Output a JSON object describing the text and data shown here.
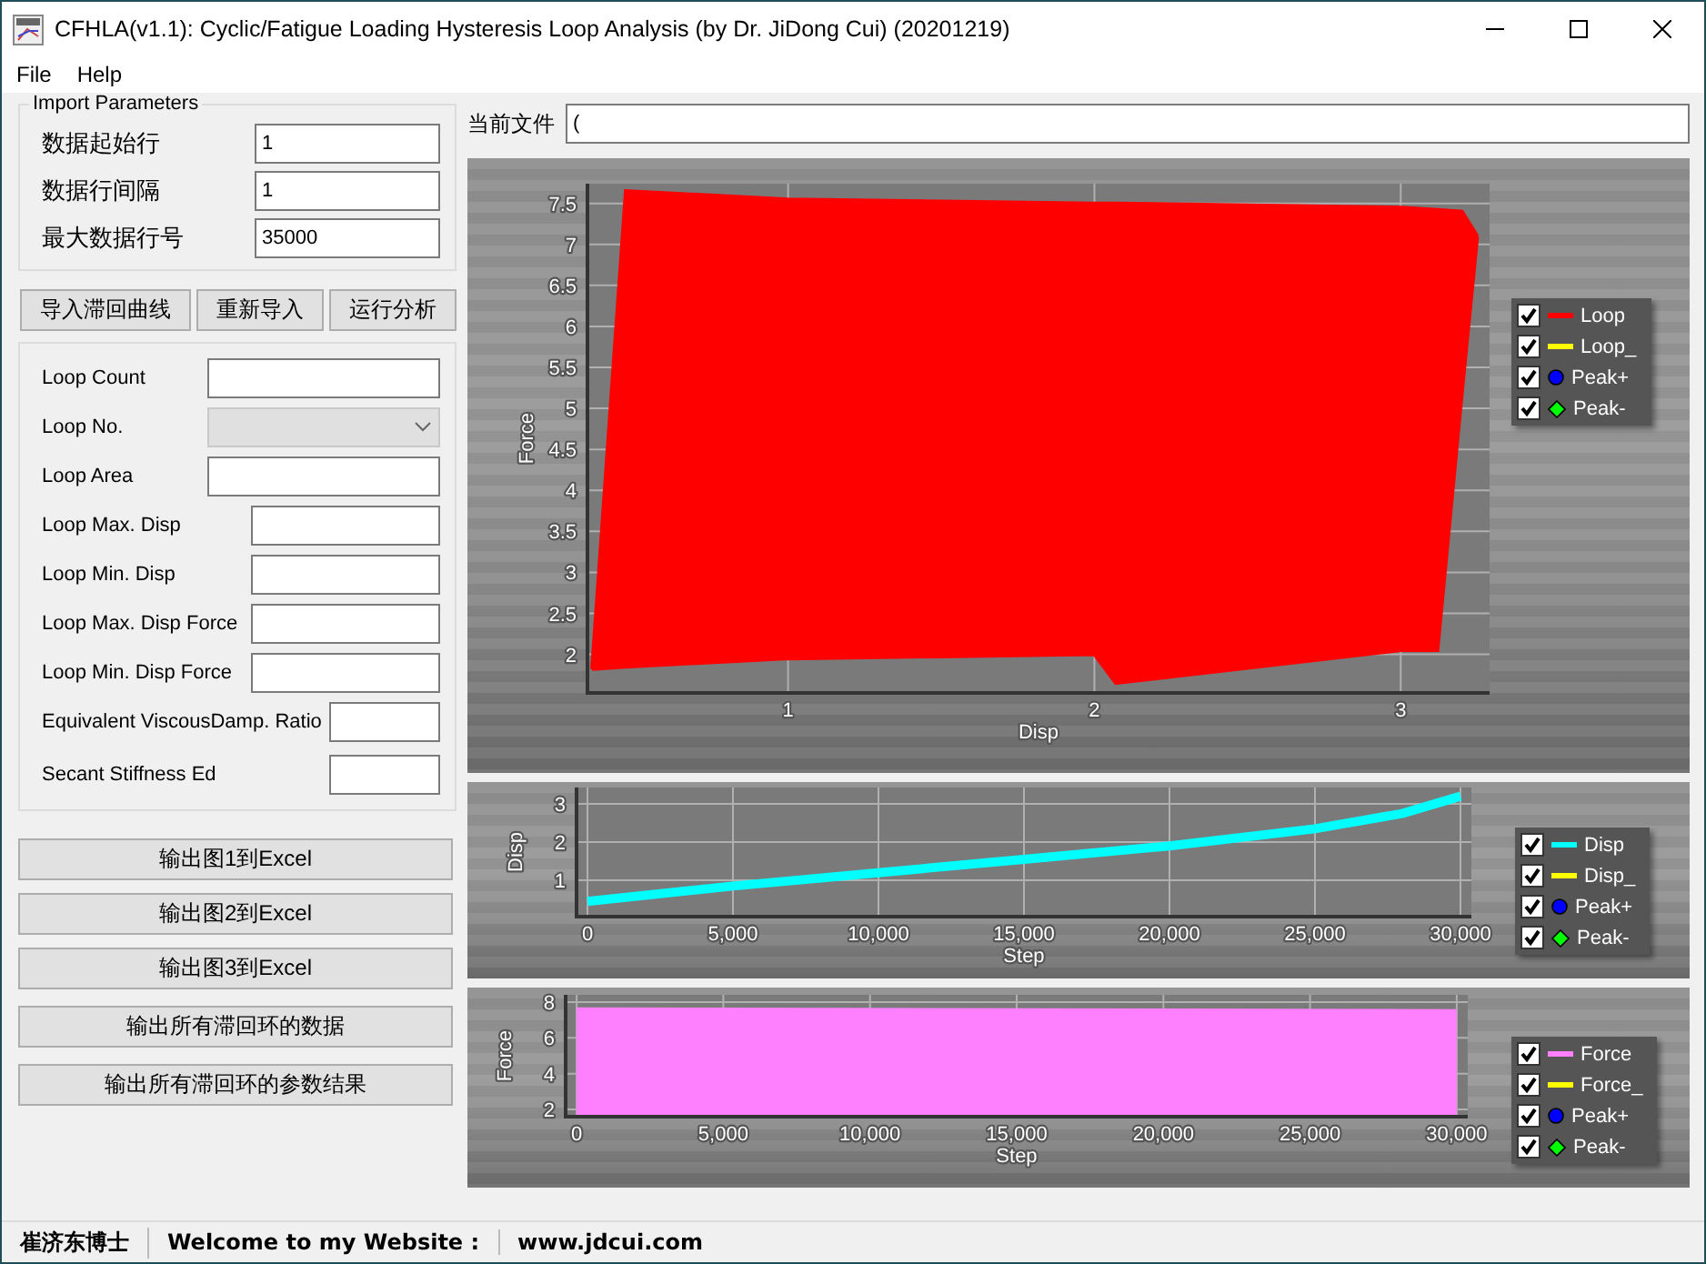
{
  "window": {
    "title": "CFHLA(v1.1): Cyclic/Fatigue Loading Hysteresis Loop Analysis (by Dr. JiDong Cui) (20201219)"
  },
  "menu": [
    "File",
    "Help"
  ],
  "import_parameters": {
    "title": "Import Parameters",
    "fields": [
      {
        "label": "数据起始行",
        "value": "1"
      },
      {
        "label": "数据行间隔",
        "value": "1"
      },
      {
        "label": "最大数据行号",
        "value": "35000"
      }
    ]
  },
  "action_buttons": [
    "导入滞回曲线",
    "重新导入",
    "运行分析"
  ],
  "results": [
    {
      "label": "Loop Count",
      "kind": "text"
    },
    {
      "label": "Loop No.",
      "kind": "dropdown",
      "disabled": true
    },
    {
      "label": "Loop Area",
      "kind": "text"
    },
    {
      "label": "Loop Max. Disp",
      "kind": "text"
    },
    {
      "label": "Loop Min. Disp",
      "kind": "text"
    },
    {
      "label": "Loop Max. Disp Force",
      "kind": "text"
    },
    {
      "label": "Loop Min. Disp Force",
      "kind": "text"
    },
    {
      "label": "Equivalent ViscousDamp. Ratio",
      "kind": "text"
    },
    {
      "label": "Secant Stiffness Ed",
      "kind": "text"
    }
  ],
  "export_buttons": [
    "输出图1到Excel",
    "输出图2到Excel",
    "输出图3到Excel",
    "输出所有滞回环的数据",
    "输出所有滞回环的参数结果"
  ],
  "current_file": {
    "label": "当前文件",
    "value": "("
  },
  "charts": [
    {
      "legend": [
        {
          "label": "Loop",
          "checked": true,
          "color": "#ff0000",
          "kind": "line"
        },
        {
          "label": "Loop_",
          "checked": true,
          "color": "#ffff00",
          "kind": "line"
        },
        {
          "label": "Peak+",
          "checked": true,
          "color": "#0000ff",
          "kind": "dot"
        },
        {
          "label": "Peak-",
          "checked": true,
          "color": "#00ff00",
          "kind": "diamond"
        }
      ],
      "chart_data": {
        "type": "line",
        "grid": true,
        "xlabel": "Disp",
        "ylabel": "Force",
        "xlim": [
          0.345,
          3.29
        ],
        "ylim": [
          1.53,
          7.74
        ],
        "xticks": [
          1,
          2,
          3
        ],
        "yticks": [
          2,
          2.5,
          3,
          3.5,
          4,
          4.5,
          5,
          5.5,
          6,
          6.5,
          7,
          7.5
        ],
        "x": [
          0.36,
          0.47,
          1.0,
          2.0,
          2.07,
          3.0,
          3.12,
          3.2,
          3.25
        ],
        "series": [
          {
            "color": "#ff0000",
            "values": [
              1.82,
              7.65,
              7.55,
              7.5,
              7.5,
              7.45,
              7.42,
              7.4,
              7.1
            ]
          },
          {
            "color": "#ff0000",
            "values": [
              1.82,
              1.85,
              1.95,
              2.0,
              1.65,
              2.05,
              2.05,
              5.2,
              7.1
            ]
          }
        ]
      }
    },
    {
      "legend": [
        {
          "label": "Disp",
          "checked": true,
          "color": "#00ffff",
          "kind": "line"
        },
        {
          "label": "Disp_",
          "checked": true,
          "color": "#ffff00",
          "kind": "line"
        },
        {
          "label": "Peak+",
          "checked": true,
          "color": "#0000ff",
          "kind": "dot"
        },
        {
          "label": "Peak-",
          "checked": true,
          "color": "#00ff00",
          "kind": "diamond"
        }
      ],
      "chart_data": {
        "type": "line",
        "grid": true,
        "xlabel": "Step",
        "ylabel": "Disp",
        "xlim": [
          -375,
          30375
        ],
        "ylim": [
          0.05,
          3.43
        ],
        "xticks": [
          {
            "value": 0,
            "label": "0"
          },
          {
            "value": 5000,
            "label": "5,000"
          },
          {
            "value": 10000,
            "label": "10,000"
          },
          {
            "value": 15000,
            "label": "15,000"
          },
          {
            "value": 20000,
            "label": "20,000"
          },
          {
            "value": 25000,
            "label": "25,000"
          },
          {
            "value": 30000,
            "label": "30,000"
          }
        ],
        "yticks": [
          1,
          2,
          3
        ],
        "x": [
          0,
          5000,
          10000,
          15000,
          20000,
          25000,
          28000,
          30000
        ],
        "series": [
          {
            "color": "#00ffff",
            "values": [
              0.45,
              0.85,
              1.2,
              1.55,
              1.9,
              2.35,
              2.75,
              3.2
            ]
          }
        ]
      }
    },
    {
      "legend": [
        {
          "label": "Force",
          "checked": true,
          "color": "#ff80ff",
          "kind": "line"
        },
        {
          "label": "Force_",
          "checked": true,
          "color": "#ffff00",
          "kind": "line"
        },
        {
          "label": "Peak+",
          "checked": true,
          "color": "#0000ff",
          "kind": "dot"
        },
        {
          "label": "Peak-",
          "checked": true,
          "color": "#00ff00",
          "kind": "diamond"
        }
      ],
      "chart_data": {
        "type": "area",
        "grid": true,
        "xlabel": "Step",
        "ylabel": "Force",
        "xlim": [
          -375,
          30375
        ],
        "ylim": [
          1.6,
          8.4
        ],
        "xticks": [
          {
            "value": 0,
            "label": "0"
          },
          {
            "value": 5000,
            "label": "5,000"
          },
          {
            "value": 10000,
            "label": "10,000"
          },
          {
            "value": 15000,
            "label": "15,000"
          },
          {
            "value": 20000,
            "label": "20,000"
          },
          {
            "value": 25000,
            "label": "25,000"
          },
          {
            "value": 30000,
            "label": "30,000"
          }
        ],
        "yticks": [
          2,
          4,
          6,
          8
        ],
        "x": [
          0,
          30000
        ],
        "series": [
          {
            "color": "#ff80ff",
            "values": [
              7.7,
              7.6
            ]
          }
        ]
      }
    }
  ],
  "status_bar": [
    "崔济东博士",
    "Welcome to my Website :",
    "www.jdcui.com"
  ]
}
